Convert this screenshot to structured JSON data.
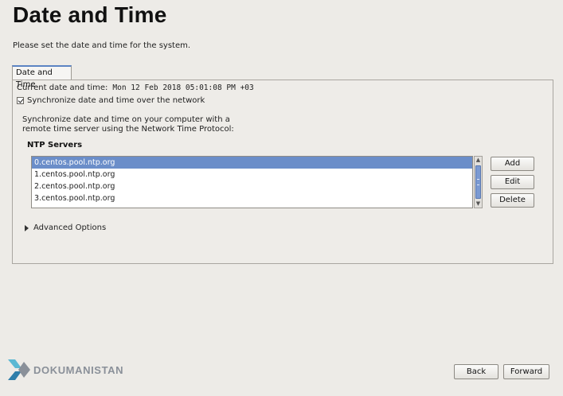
{
  "page": {
    "title": "Date and Time",
    "subtitle": "Please set the date and time for the system."
  },
  "tabs": [
    {
      "label": "Date and Time",
      "active": true
    }
  ],
  "panel": {
    "current_label": "Current date and time:",
    "current_value": "Mon 12 Feb 2018 05:01:08 PM +03",
    "sync_checkbox": {
      "label": "Synchronize date and time over the network",
      "checked": true
    },
    "description_line1": "Synchronize date and time on your computer with a",
    "description_line2": "remote time server using the Network Time Protocol:",
    "ntp_header": "NTP Servers",
    "ntp_servers": [
      {
        "host": "0.centos.pool.ntp.org",
        "selected": true
      },
      {
        "host": "1.centos.pool.ntp.org",
        "selected": false
      },
      {
        "host": "2.centos.pool.ntp.org",
        "selected": false
      },
      {
        "host": "3.centos.pool.ntp.org",
        "selected": false
      }
    ],
    "buttons": {
      "add": "Add",
      "edit": "Edit",
      "delete": "Delete"
    },
    "advanced_options": "Advanced Options"
  },
  "footer": {
    "logo_text": "DOKUMANISTAN",
    "back": "Back",
    "forward": "Forward"
  },
  "colors": {
    "background": "#edebe7",
    "selection": "#6b8ec9",
    "tab_accent": "#5c84c3",
    "logo_text": "#8a9099"
  }
}
